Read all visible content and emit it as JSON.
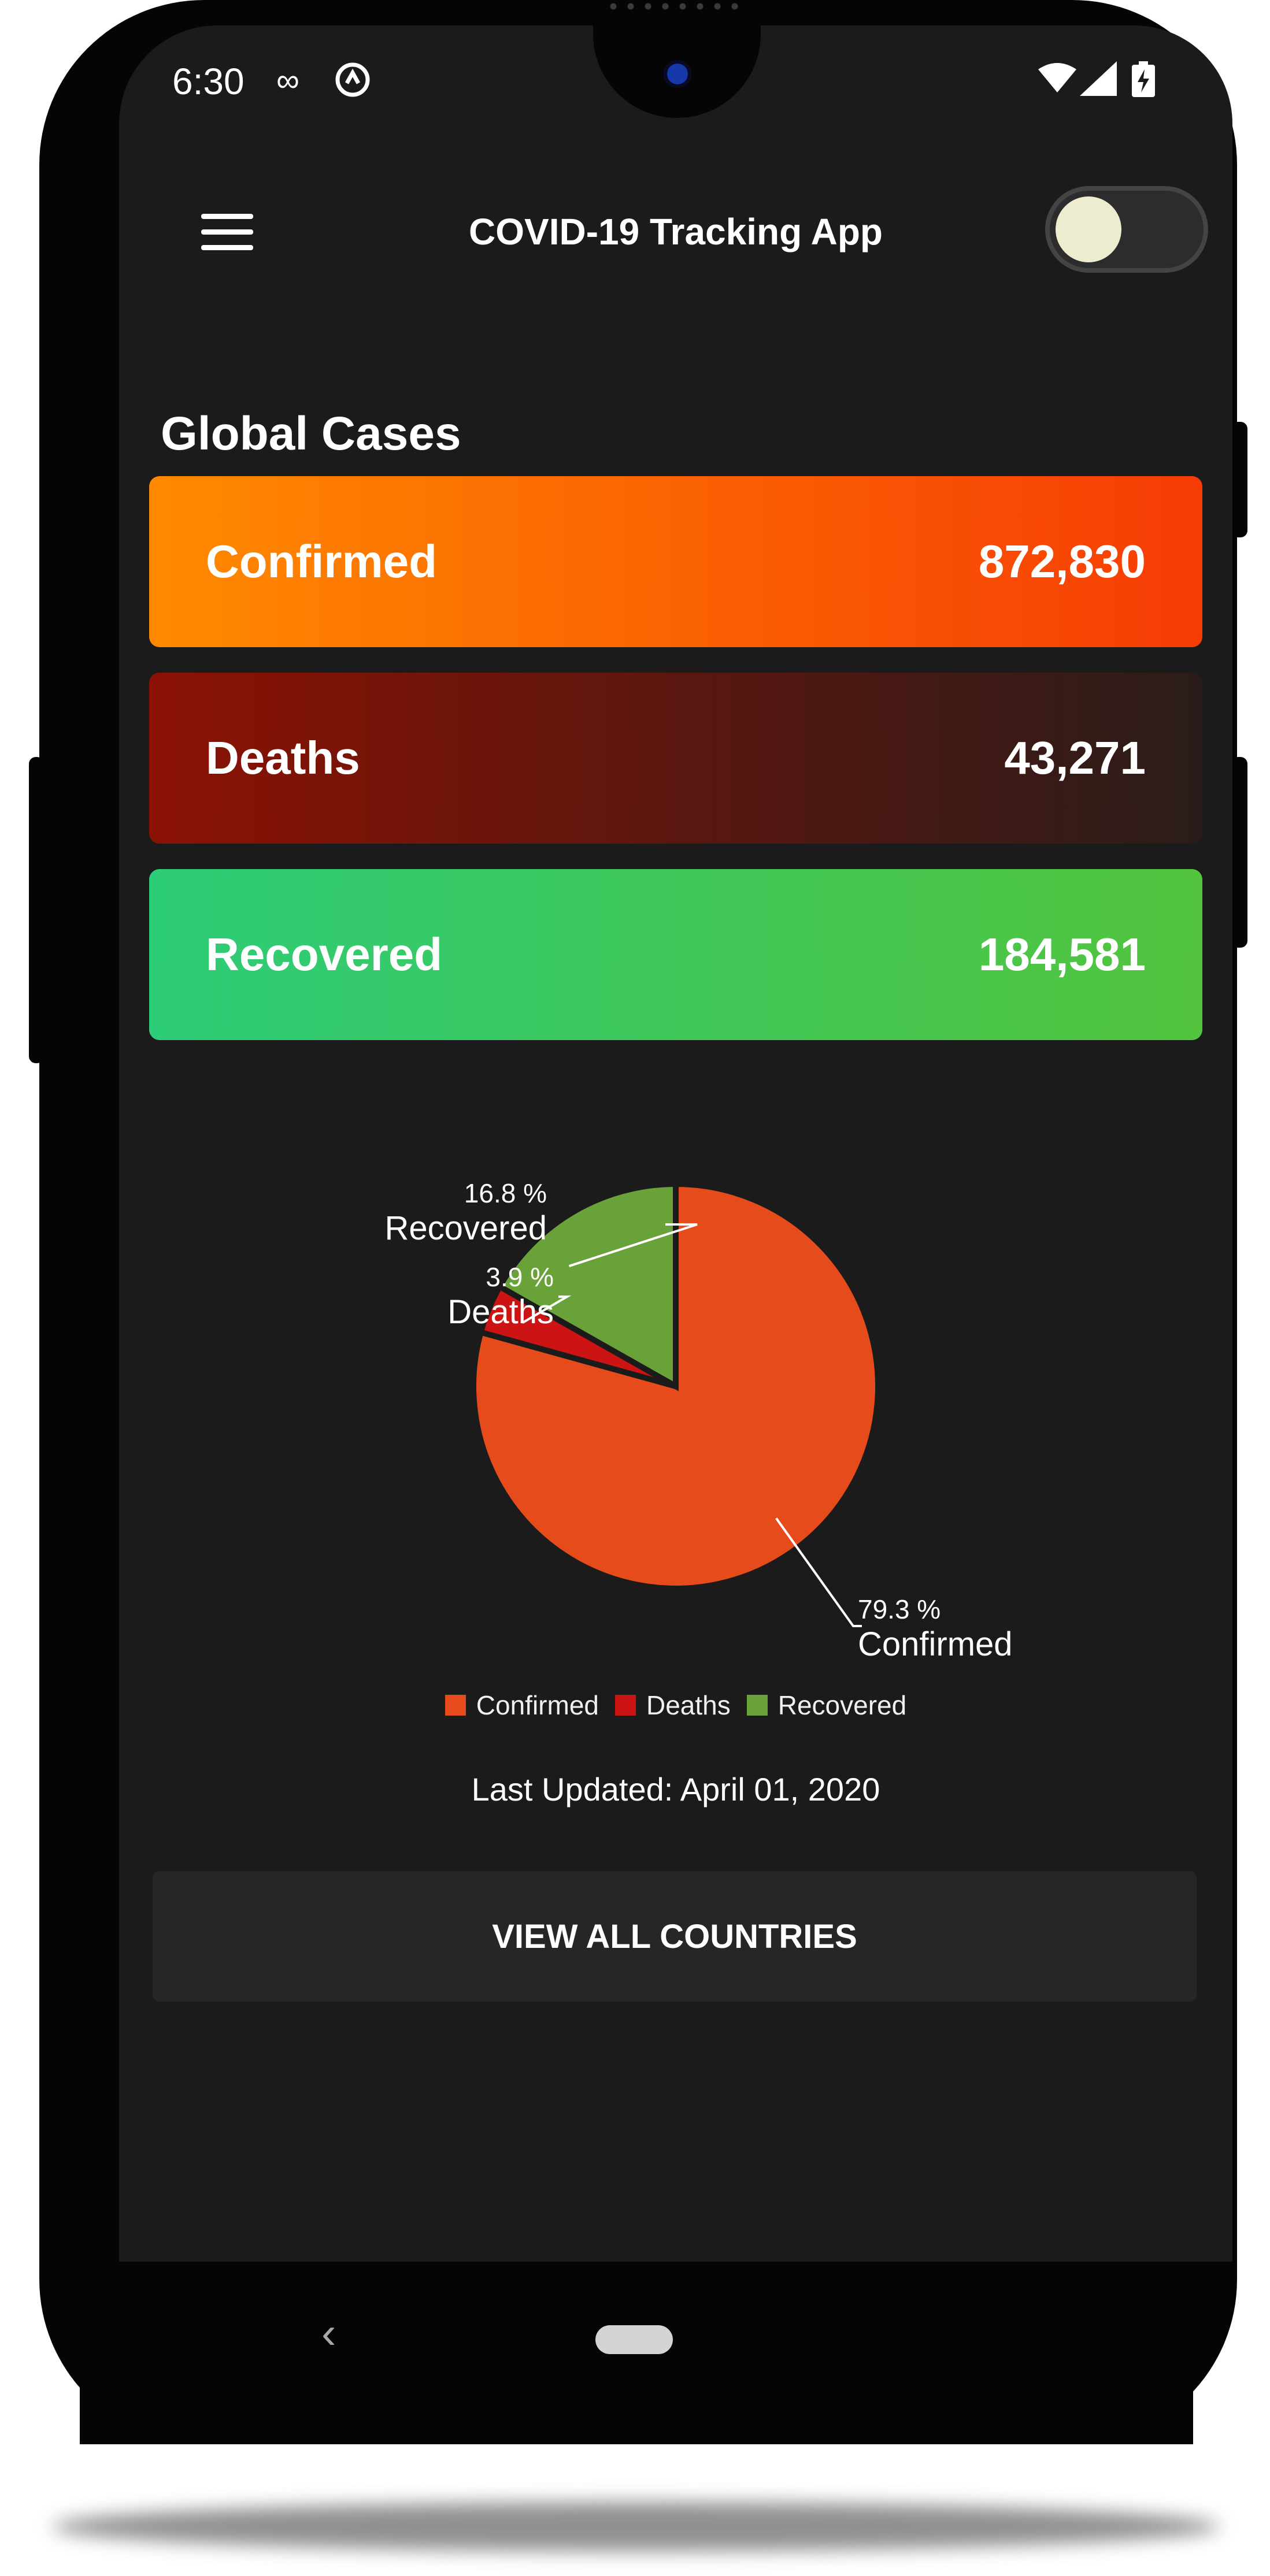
{
  "status_bar": {
    "time": "6:30",
    "icons": [
      "voicemail-icon",
      "sync-icon",
      "wifi-icon",
      "signal-icon",
      "battery-charging-icon"
    ]
  },
  "toolbar": {
    "title": "COVID-19 Tracking App",
    "menu_icon": "hamburger-menu-icon",
    "theme_toggle_state": "dark"
  },
  "global": {
    "section_title": "Global Cases",
    "cards": [
      {
        "label": "Confirmed",
        "value": "872,830",
        "gradient": [
          "#ff8a00",
          "#f63c05"
        ]
      },
      {
        "label": "Deaths",
        "value": "43,271",
        "gradient": [
          "#8b1204",
          "#2a1c1a"
        ]
      },
      {
        "label": "Recovered",
        "value": "184,581",
        "gradient": [
          "#2dcc78",
          "#52c43d"
        ]
      }
    ]
  },
  "chart_data": {
    "type": "pie",
    "slices": [
      {
        "name": "Confirmed",
        "value": 79.3,
        "label": "79.3 %",
        "color": "#e54b1b"
      },
      {
        "name": "Deaths",
        "value": 3.9,
        "label": "3.9 %",
        "color": "#cc1414"
      },
      {
        "name": "Recovered",
        "value": 16.8,
        "label": "16.8 %",
        "color": "#6aa23a"
      }
    ],
    "legend": [
      "Confirmed",
      "Deaths",
      "Recovered"
    ],
    "legend_position": "bottom"
  },
  "footer": {
    "last_updated": "Last Updated: April 01, 2020",
    "view_all_label": "VIEW ALL COUNTRIES"
  },
  "nav_bar": {
    "back_icon": "back-chevron-icon",
    "home_icon": "home-pill-icon"
  },
  "colors": {
    "background": "#1c1b1c",
    "button": "#262626",
    "phone_frame": "#050505"
  }
}
